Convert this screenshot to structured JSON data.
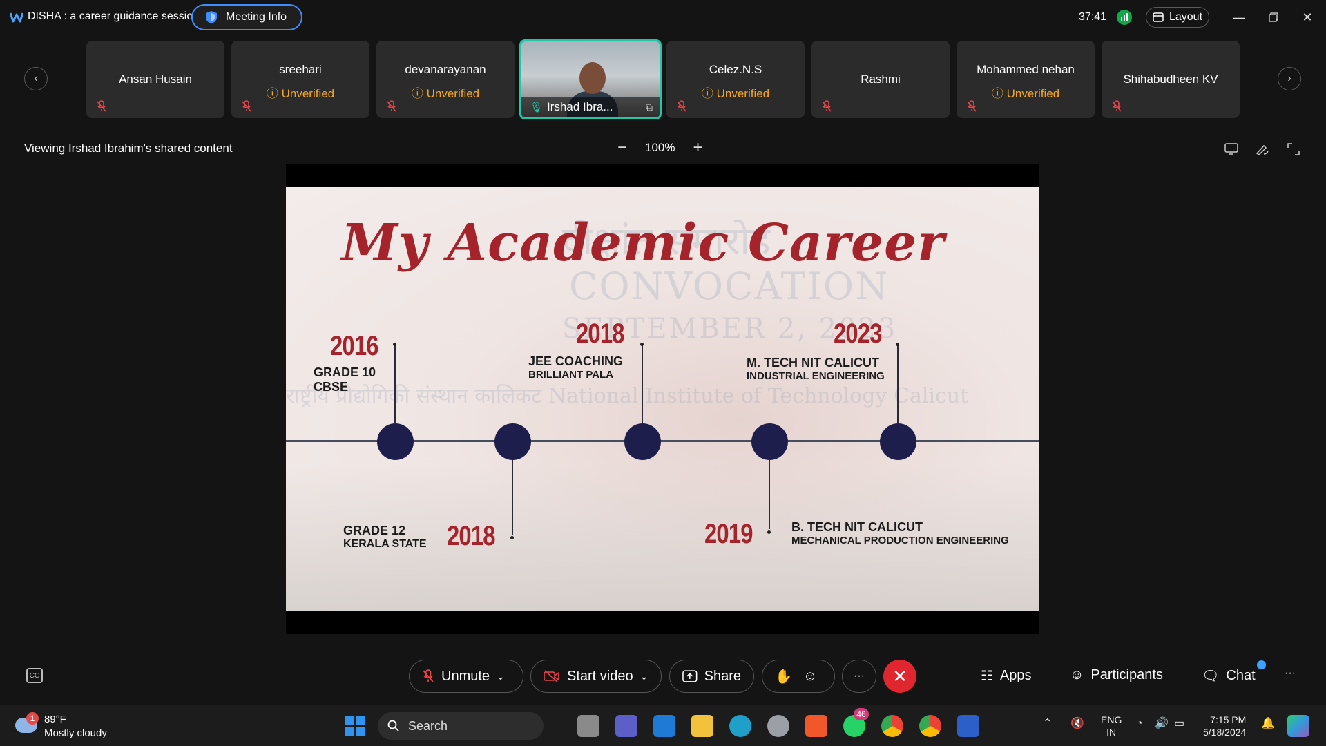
{
  "window": {
    "title": "DISHA : a career guidance session",
    "meeting_info_label": "Meeting Info",
    "timer": "37:41",
    "layout_label": "Layout"
  },
  "participants": [
    {
      "name": "Ansan  Husain",
      "status": ""
    },
    {
      "name": "sreehari",
      "status": "Unverified"
    },
    {
      "name": "devanarayanan",
      "status": "Unverified"
    },
    {
      "name": "Irshad Ibra...",
      "status": "",
      "active": true
    },
    {
      "name": "Celez.N.S",
      "status": "Unverified"
    },
    {
      "name": "Rashmi",
      "status": ""
    },
    {
      "name": "Mohammed nehan",
      "status": "Unverified"
    },
    {
      "name": "Shihabudheen KV",
      "status": ""
    }
  ],
  "share": {
    "viewing_text": "Viewing Irshad Ibrahim's shared content",
    "zoom": "100%",
    "zoom_minus": "−",
    "zoom_plus": "+"
  },
  "slide": {
    "title": "My Academic Career",
    "watermark_convocation": "CONVOCATION",
    "watermark_date": "SEPTEMBER 2, 2023",
    "watermark_hindi": "दीक्षांत समारोह",
    "watermark_institute": "राष्ट्रीय प्रौद्योगिकी संस्थान कालिकट  National Institute of Technology Calicut",
    "events": [
      {
        "year": "2016",
        "line1": "GRADE 10",
        "line2": "CBSE"
      },
      {
        "year": "2018",
        "line1": "GRADE 12",
        "line2": "KERALA STATE"
      },
      {
        "year": "2018",
        "line1": "JEE COACHING",
        "line2": "BRILLIANT PALA"
      },
      {
        "year": "2019",
        "line1": "B. TECH NIT CALICUT",
        "line2": "MECHANICAL PRODUCTION ENGINEERING"
      },
      {
        "year": "2023",
        "line1": "M. TECH NIT CALICUT",
        "line2": "INDUSTRIAL ENGINEERING"
      }
    ]
  },
  "toolbar": {
    "unmute": "Unmute",
    "start_video": "Start video",
    "share": "Share",
    "more": "···",
    "apps": "Apps",
    "participants": "Participants",
    "chat": "Chat",
    "overflow": "···"
  },
  "taskbar": {
    "weather_badge": "1",
    "temperature": "89°F",
    "condition": "Mostly cloudy",
    "search_placeholder": "Search",
    "whatsapp_badge": "46",
    "lang_line1": "ENG",
    "lang_line2": "IN",
    "time": "7:15 PM",
    "date": "5/18/2024"
  },
  "colors": {
    "accent_blue": "#3f8cff",
    "active_tile_border": "#1fc7a6",
    "unverified": "#f5a623",
    "end_call": "#e0262e",
    "slide_title": "#a5232a",
    "timeline_node": "#1e1e4d"
  }
}
